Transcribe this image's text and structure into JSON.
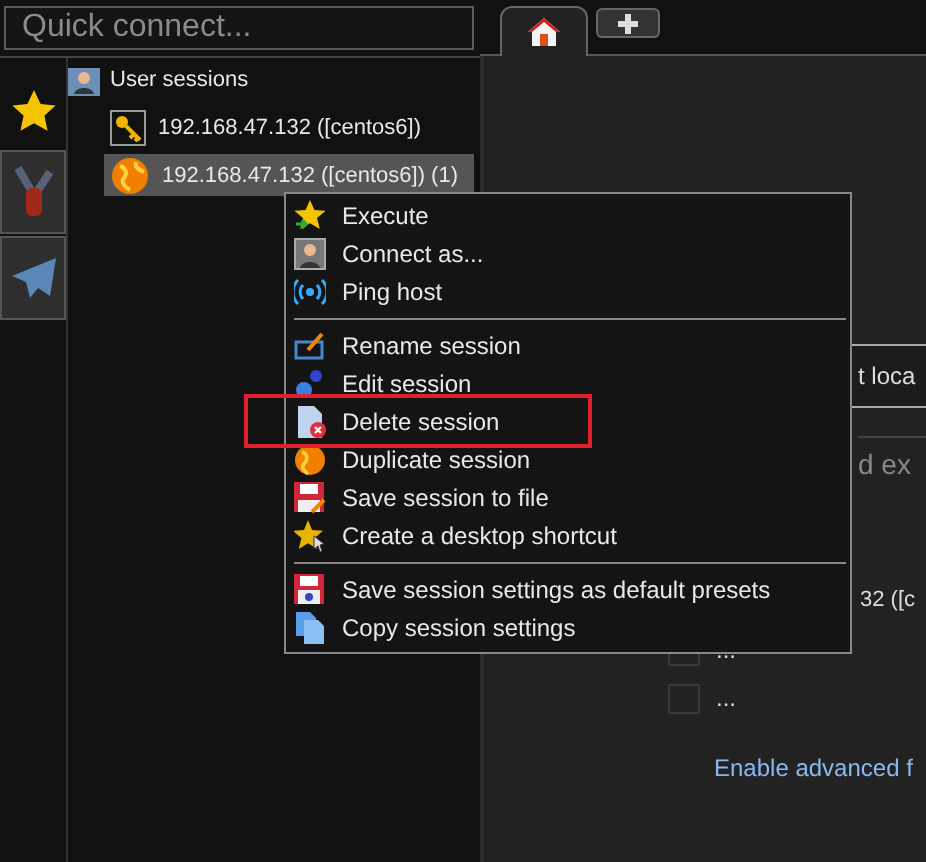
{
  "quick_connect": {
    "placeholder": "Quick connect..."
  },
  "side_tabs": [
    {
      "kind": "star",
      "selected": true
    },
    {
      "kind": "tools",
      "selected": false
    },
    {
      "kind": "send",
      "selected": false
    }
  ],
  "tree": {
    "label": "User sessions",
    "children": [
      {
        "label": "192.168.47.132 ([centos6])",
        "kind": "key",
        "selected": false
      },
      {
        "label": "192.168.47.132 ([centos6]) (1)",
        "kind": "globe",
        "selected": true
      }
    ]
  },
  "tabs": [
    {
      "kind": "home",
      "selected": true
    },
    {
      "kind": "add",
      "selected": false
    }
  ],
  "background": {
    "field_1": {
      "value": "t loca"
    },
    "field_2": {
      "placeholder": "d ex"
    },
    "text_1": "32 ([c",
    "rows": [
      "...",
      "..."
    ],
    "link": "Enable advanced f"
  },
  "context_menu": {
    "groups": [
      [
        {
          "label": "Execute",
          "kind": "execute",
          "highlighted": false
        },
        {
          "label": "Connect as...",
          "kind": "user",
          "highlighted": false
        },
        {
          "label": "Ping host",
          "kind": "ping",
          "highlighted": false
        }
      ],
      [
        {
          "label": "Rename session",
          "kind": "rename",
          "highlighted": false
        },
        {
          "label": "Edit session",
          "kind": "edit",
          "highlighted": false
        },
        {
          "label": "Delete session",
          "kind": "delete",
          "highlighted": true
        },
        {
          "label": "Duplicate session",
          "kind": "globe",
          "highlighted": false
        },
        {
          "label": "Save session to file",
          "kind": "save",
          "highlighted": false
        },
        {
          "label": "Create a desktop shortcut",
          "kind": "shortcut",
          "highlighted": false
        }
      ],
      [
        {
          "label": "Save session settings as default presets",
          "kind": "presets",
          "highlighted": false
        },
        {
          "label": "Copy session settings",
          "kind": "copy",
          "highlighted": false
        }
      ]
    ]
  }
}
